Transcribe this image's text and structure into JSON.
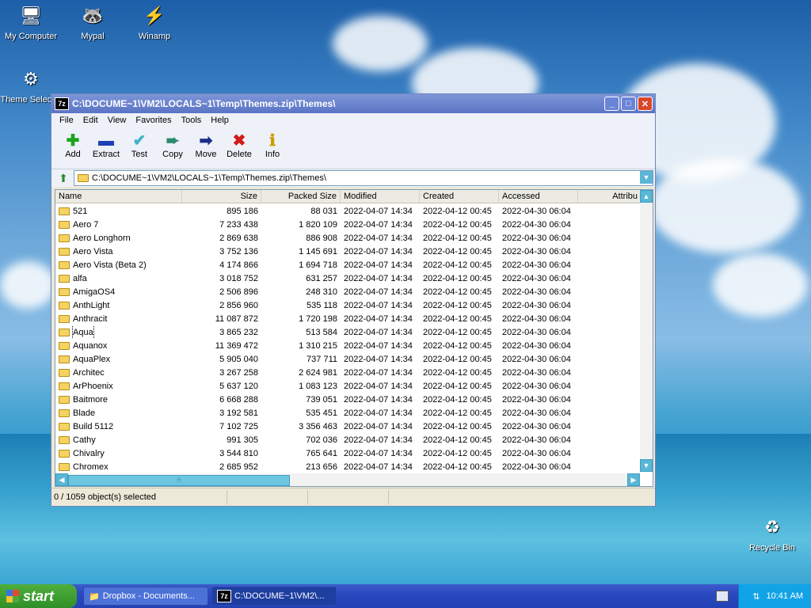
{
  "desktop": {
    "icons": [
      {
        "label": "My Computer",
        "icon": "computer-icon"
      },
      {
        "label": "Mypal",
        "icon": "raccoon-icon"
      },
      {
        "label": "Winamp",
        "icon": "winamp-icon"
      },
      {
        "label": "Theme Select...",
        "icon": "theme-selector-icon"
      },
      {
        "label": "Recycle Bin",
        "icon": "recycle-bin-icon"
      }
    ]
  },
  "window": {
    "app_badge": "7z",
    "title": "C:\\DOCUME~1\\VM2\\LOCALS~1\\Temp\\Themes.zip\\Themes\\",
    "menu": [
      "File",
      "Edit",
      "View",
      "Favorites",
      "Tools",
      "Help"
    ],
    "toolbar": [
      {
        "label": "Add",
        "icon": "plus-icon",
        "color": "#1aa51a"
      },
      {
        "label": "Extract",
        "icon": "minus-icon",
        "color": "#1f3fb4"
      },
      {
        "label": "Test",
        "icon": "check-icon",
        "color": "#3fb4c8"
      },
      {
        "label": "Copy",
        "icon": "copy-arrow-icon",
        "color": "#2e8a6e"
      },
      {
        "label": "Move",
        "icon": "move-arrow-icon",
        "color": "#1a2e8a"
      },
      {
        "label": "Delete",
        "icon": "delete-x-icon",
        "color": "#d31a1a"
      },
      {
        "label": "Info",
        "icon": "info-icon",
        "color": "#c8a000"
      }
    ],
    "address": "C:\\DOCUME~1\\VM2\\LOCALS~1\\Temp\\Themes.zip\\Themes\\",
    "columns": [
      "Name",
      "Size",
      "Packed Size",
      "Modified",
      "Created",
      "Accessed",
      "Attribu"
    ],
    "rows": [
      [
        "521",
        "895 186",
        "88 031",
        "2022-04-07 14:34",
        "2022-04-12 00:45",
        "2022-04-30 06:04"
      ],
      [
        "Aero 7",
        "7 233 438",
        "1 820 109",
        "2022-04-07 14:34",
        "2022-04-12 00:45",
        "2022-04-30 06:04"
      ],
      [
        "Aero Longhorn",
        "2 869 638",
        "886 908",
        "2022-04-07 14:34",
        "2022-04-12 00:45",
        "2022-04-30 06:04"
      ],
      [
        "Aero Vista",
        "3 752 136",
        "1 145 691",
        "2022-04-07 14:34",
        "2022-04-12 00:45",
        "2022-04-30 06:04"
      ],
      [
        "Aero Vista (Beta 2)",
        "4 174 866",
        "1 694 718",
        "2022-04-07 14:34",
        "2022-04-12 00:45",
        "2022-04-30 06:04"
      ],
      [
        "alfa",
        "3 018 752",
        "631 257",
        "2022-04-07 14:34",
        "2022-04-12 00:45",
        "2022-04-30 06:04"
      ],
      [
        "AmigaOS4",
        "2 506 896",
        "248 310",
        "2022-04-07 14:34",
        "2022-04-12 00:45",
        "2022-04-30 06:04"
      ],
      [
        "AnthLight",
        "2 856 960",
        "535 118",
        "2022-04-07 14:34",
        "2022-04-12 00:45",
        "2022-04-30 06:04"
      ],
      [
        "Anthracit",
        "11 087 872",
        "1 720 198",
        "2022-04-07 14:34",
        "2022-04-12 00:45",
        "2022-04-30 06:04"
      ],
      [
        "Aqua",
        "3 865 232",
        "513 584",
        "2022-04-07 14:34",
        "2022-04-12 00:45",
        "2022-04-30 06:04"
      ],
      [
        "Aquanox",
        "11 369 472",
        "1 310 215",
        "2022-04-07 14:34",
        "2022-04-12 00:45",
        "2022-04-30 06:04"
      ],
      [
        "AquaPlex",
        "5 905 040",
        "737 711",
        "2022-04-07 14:34",
        "2022-04-12 00:45",
        "2022-04-30 06:04"
      ],
      [
        "Architec",
        "3 267 258",
        "2 624 981",
        "2022-04-07 14:34",
        "2022-04-12 00:45",
        "2022-04-30 06:04"
      ],
      [
        "ArPhoenix",
        "5 637 120",
        "1 083 123",
        "2022-04-07 14:34",
        "2022-04-12 00:45",
        "2022-04-30 06:04"
      ],
      [
        "Baitmore",
        "6 668 288",
        "739 051",
        "2022-04-07 14:34",
        "2022-04-12 00:45",
        "2022-04-30 06:04"
      ],
      [
        "Blade",
        "3 192 581",
        "535 451",
        "2022-04-07 14:34",
        "2022-04-12 00:45",
        "2022-04-30 06:04"
      ],
      [
        "Build 5112",
        "7 102 725",
        "3 356 463",
        "2022-04-07 14:34",
        "2022-04-12 00:45",
        "2022-04-30 06:04"
      ],
      [
        "Cathy",
        "991 305",
        "702 036",
        "2022-04-07 14:34",
        "2022-04-12 00:45",
        "2022-04-30 06:04"
      ],
      [
        "Chivalry",
        "3 544 810",
        "765 641",
        "2022-04-07 14:34",
        "2022-04-12 00:45",
        "2022-04-30 06:04"
      ],
      [
        "Chromex",
        "2 685 952",
        "213 656",
        "2022-04-07 14:34",
        "2022-04-12 00:45",
        "2022-04-30 06:04"
      ]
    ],
    "focused_row": "Aqua",
    "status": "0 / 1059 object(s) selected"
  },
  "taskbar": {
    "start_label": "start",
    "tasks": [
      {
        "label": "Dropbox - Documents...",
        "active": false
      },
      {
        "label": "C:\\DOCUME~1\\VM2\\...",
        "active": true,
        "badge": "7z"
      }
    ],
    "clock": "10:41 AM"
  },
  "colors": {
    "title_bar": "#5a74c4",
    "taskbar": "#2a49c0",
    "start_button": "#3c9a30",
    "tray": "#12a3e6",
    "scroll_accent": "#59b6d6"
  }
}
